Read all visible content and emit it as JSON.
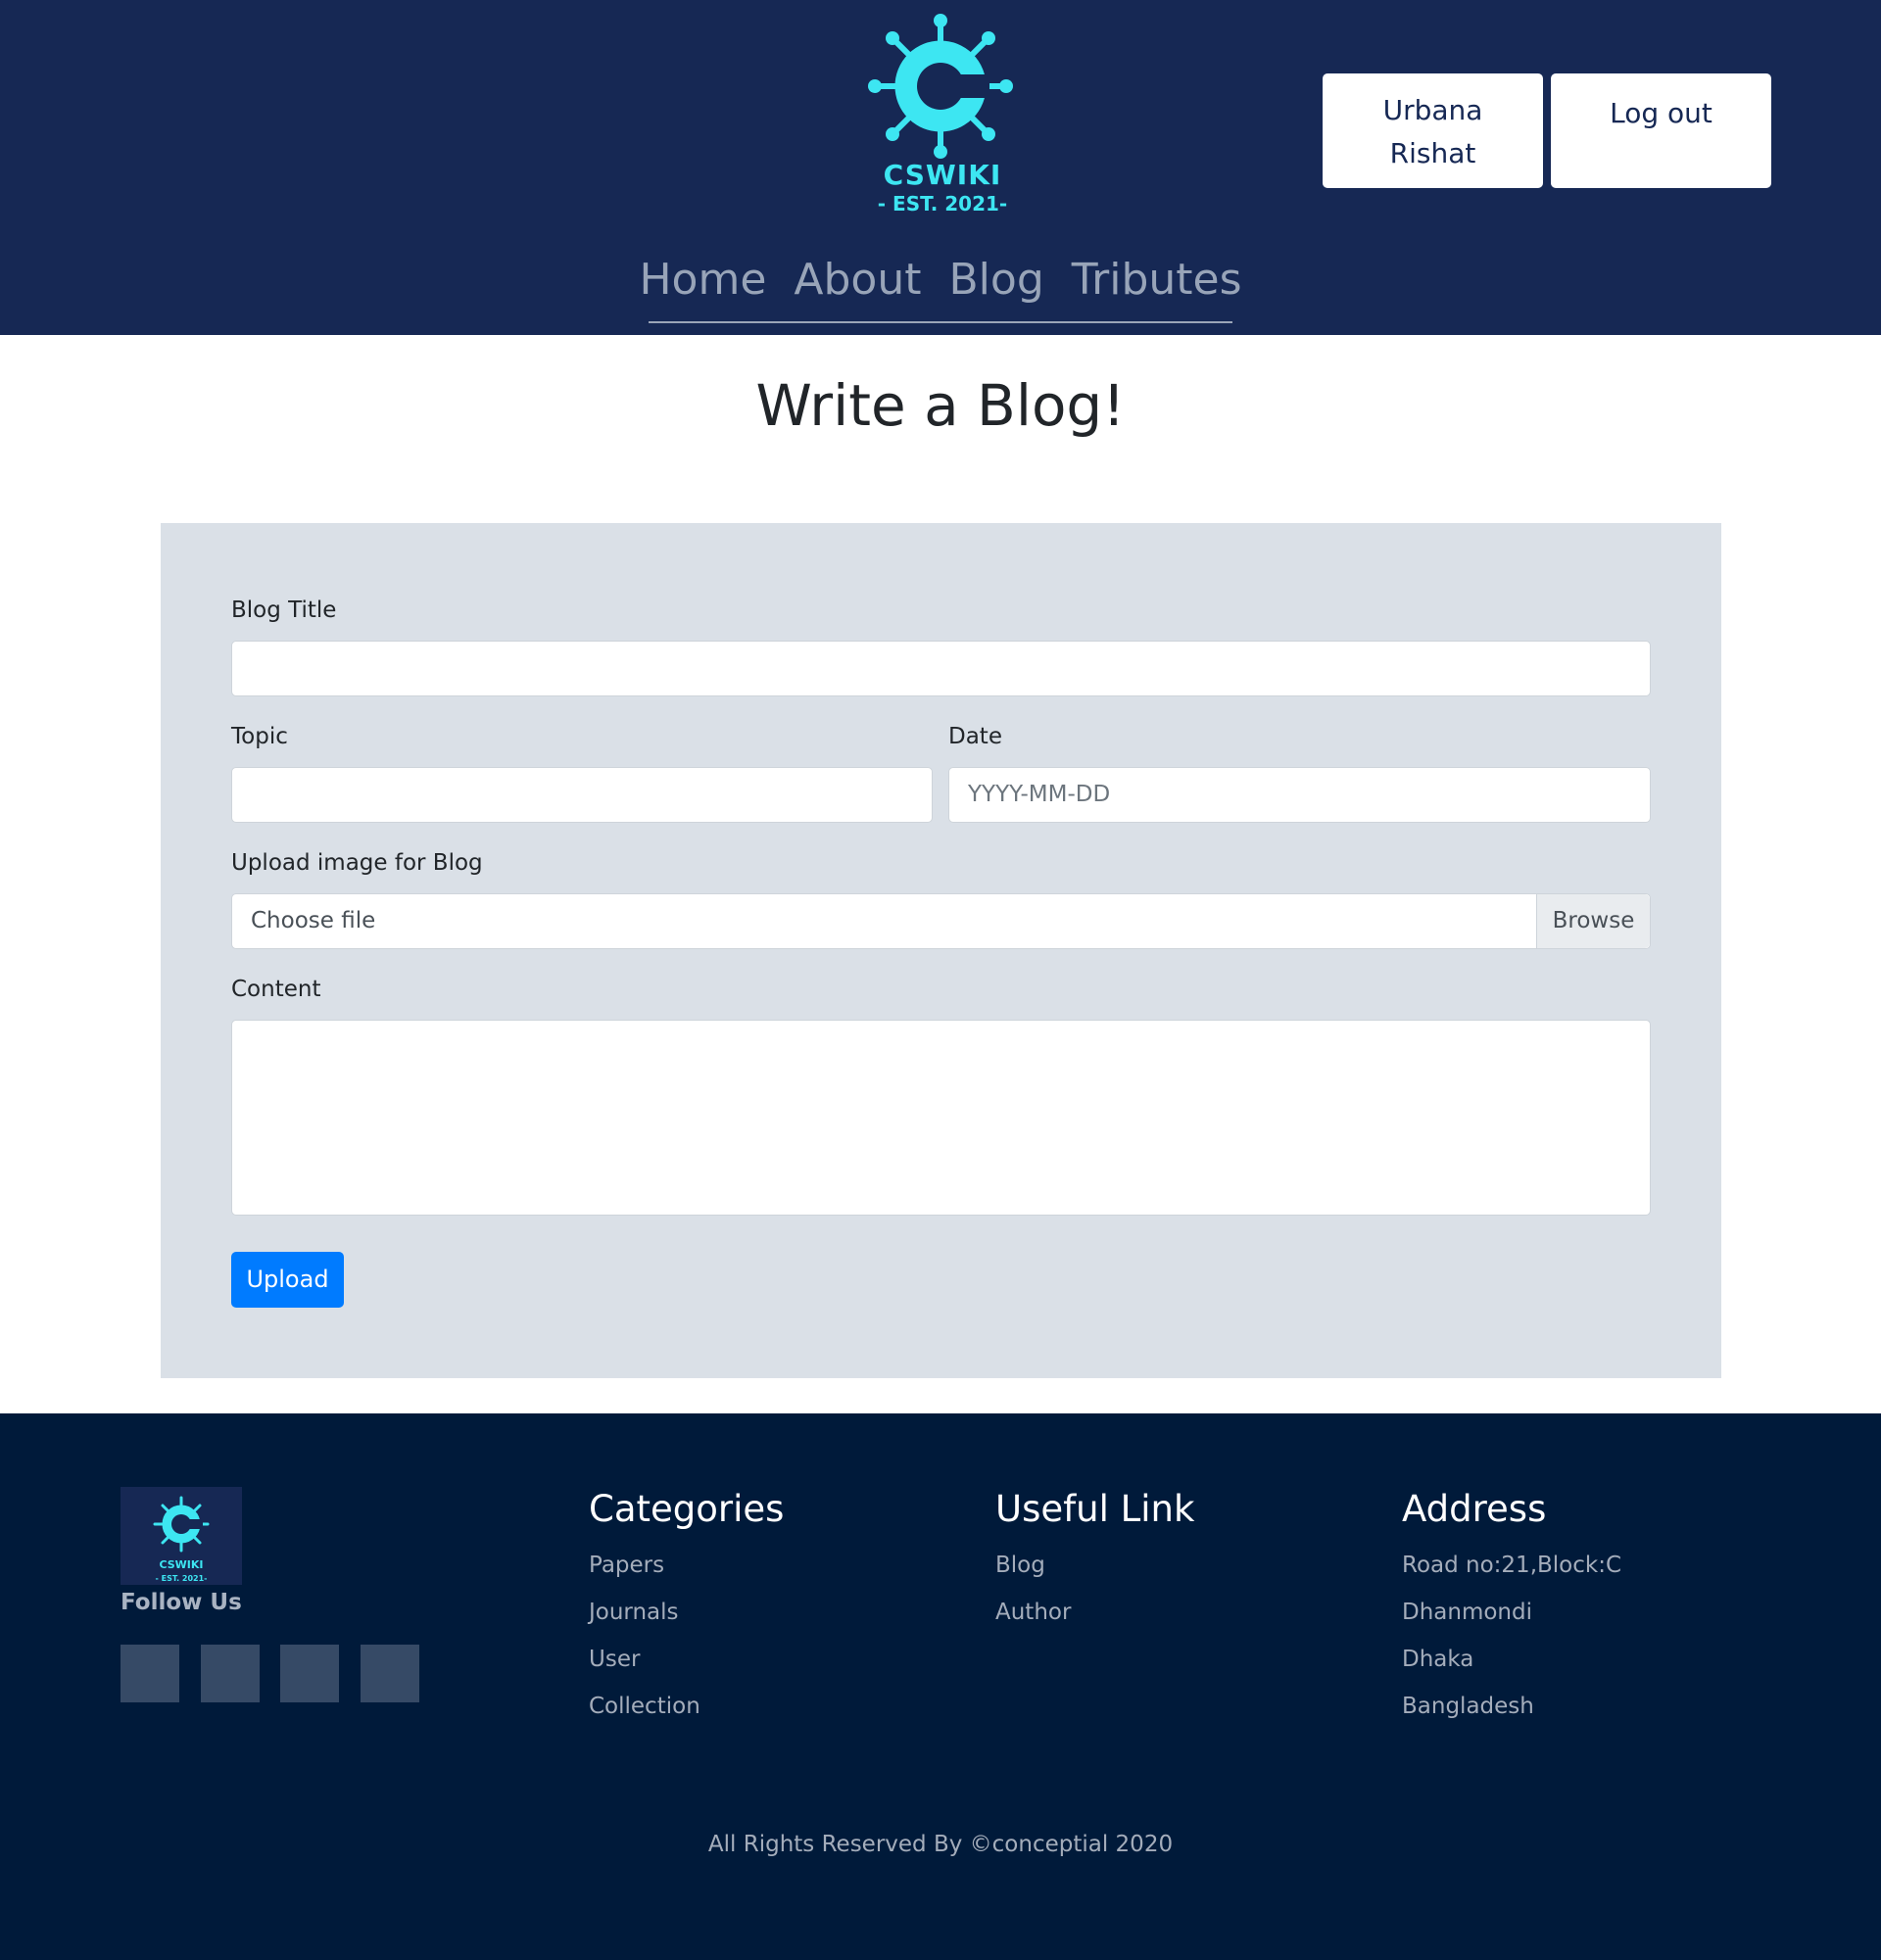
{
  "header": {
    "logo": {
      "name": "CSWIKI",
      "est": "- EST. 2021-",
      "icon": "virus-c-logo-icon",
      "color": "#3de6f2"
    },
    "user_button": {
      "line1": "Urbana",
      "line2": "Rishat"
    },
    "logout_label": "Log out",
    "nav": [
      "Home",
      "About",
      "Blog",
      "Tributes"
    ]
  },
  "main": {
    "title": "Write a Blog!",
    "form": {
      "blog_title_label": "Blog Title",
      "blog_title_value": "",
      "topic_label": "Topic",
      "topic_value": "",
      "date_label": "Date",
      "date_placeholder": "YYYY-MM-DD",
      "upload_label": "Upload image for Blog",
      "file_placeholder": "Choose file",
      "browse_label": "Browse",
      "content_label": "Content",
      "content_value": "",
      "submit_label": "Upload"
    }
  },
  "footer": {
    "logo": {
      "name": "CSWIKI",
      "est": "- EST. 2021-"
    },
    "follow_us": "Follow Us",
    "social_icons": [
      "social-icon-1",
      "social-icon-2",
      "social-icon-3",
      "social-icon-4"
    ],
    "categories": {
      "heading": "Categories",
      "items": [
        "Papers",
        "Journals",
        "User",
        "Collection"
      ]
    },
    "useful_link": {
      "heading": "Useful Link",
      "items": [
        "Blog",
        "Author"
      ]
    },
    "address": {
      "heading": "Address",
      "items": [
        "Road no:21,Block:C",
        "Dhanmondi",
        "Dhaka",
        "Bangladesh"
      ]
    },
    "copyright": "All Rights Reserved By ©conceptial 2020"
  },
  "colors": {
    "header_bg": "#162854",
    "footer_bg": "#001a3a",
    "panel_bg": "#dae0e7",
    "primary": "#007bff",
    "logo_accent": "#3de6f2"
  }
}
